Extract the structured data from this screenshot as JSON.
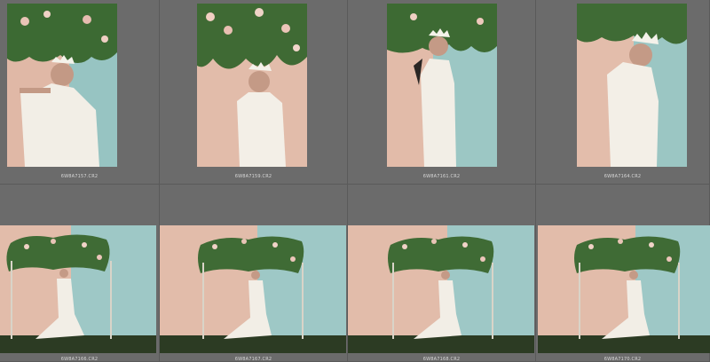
{
  "colors": {
    "grid_background": "#6b6b6b",
    "cell_border": "#5a5a5a",
    "wall_pink": "#e4bfae",
    "wall_teal": "#9fc9c7",
    "foliage": "#3f6b35",
    "flowers": "#e8c0b4",
    "dress": "#f2efe8",
    "floor": "#2b3a22"
  },
  "photos": [
    {
      "filename": "6W8A7157.CR2",
      "scene": "portrait-closeup",
      "icon": "photo-thumbnail-icon"
    },
    {
      "filename": "6W8A7159.CR2",
      "scene": "portrait-closeup",
      "icon": "photo-thumbnail-icon"
    },
    {
      "filename": "6W8A7161.CR2",
      "scene": "portrait-profile",
      "icon": "photo-thumbnail-icon"
    },
    {
      "filename": "6W8A7164.CR2",
      "scene": "portrait-closeup",
      "icon": "photo-thumbnail-icon"
    },
    {
      "filename": "6W8A7166.CR2",
      "scene": "full-length-arch",
      "icon": "photo-thumbnail-icon"
    },
    {
      "filename": "6W8A7167.CR2",
      "scene": "full-length-arch",
      "icon": "photo-thumbnail-icon"
    },
    {
      "filename": "6W8A7168.CR2",
      "scene": "full-length-arch",
      "icon": "photo-thumbnail-icon"
    },
    {
      "filename": "6W8A7170.CR2",
      "scene": "full-length-arch",
      "icon": "photo-thumbnail-icon"
    }
  ]
}
